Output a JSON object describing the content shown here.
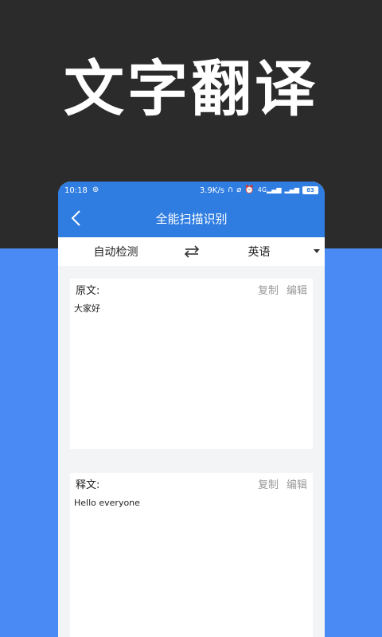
{
  "promo": {
    "title": "文字翻译"
  },
  "status_bar": {
    "time": "10:18",
    "net_speed": "3.9K/s",
    "network_type": "4G",
    "battery": "83"
  },
  "header": {
    "title": "全能扫描识别"
  },
  "language_bar": {
    "source_lang": "自动检测",
    "target_lang": "英语"
  },
  "source_card": {
    "label": "原文:",
    "copy_label": "复制",
    "edit_label": "编辑",
    "text": "大家好"
  },
  "target_card": {
    "label": "释文:",
    "copy_label": "复制",
    "edit_label": "编辑",
    "text": "Hello everyone"
  },
  "colors": {
    "accent": "#2f7de1",
    "bg_dark": "#2b2b2b",
    "bg_blue": "#4a8af4"
  }
}
